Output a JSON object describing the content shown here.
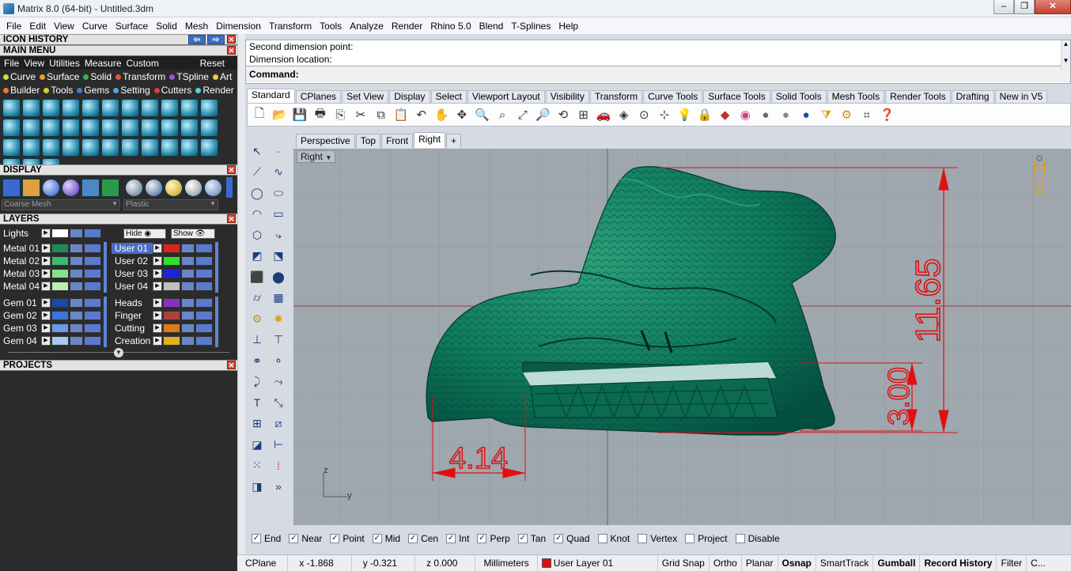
{
  "window": {
    "title": "Matrix 8.0 (64-bit) - Untitled.3dm",
    "min": "–",
    "max": "❐",
    "close": "✕"
  },
  "menubar": [
    "File",
    "Edit",
    "View",
    "Curve",
    "Surface",
    "Solid",
    "Mesh",
    "Dimension",
    "Transform",
    "Tools",
    "Analyze",
    "Render",
    "Rhino 5.0",
    "Blend",
    "T-Splines",
    "Help"
  ],
  "left": {
    "icon_history": "ICON HISTORY",
    "main_menu": "MAIN MENU",
    "mm_top": [
      "File",
      "View",
      "Utilities",
      "Measure",
      "Custom"
    ],
    "reset": "Reset",
    "mm_row2": [
      {
        "label": "Curve",
        "color": "#d8d84a"
      },
      {
        "label": "Surface",
        "color": "#e0a030"
      },
      {
        "label": "Solid",
        "color": "#3cb05a"
      },
      {
        "label": "Transform",
        "color": "#d85a3a"
      },
      {
        "label": "TSpline",
        "color": "#9060c8"
      },
      {
        "label": "Art",
        "color": "#e0d040"
      }
    ],
    "mm_row3": [
      {
        "label": "Builder",
        "color": "#e07a30"
      },
      {
        "label": "Tools",
        "color": "#d8c840"
      },
      {
        "label": "Gems",
        "color": "#4a7ad8"
      },
      {
        "label": "Setting",
        "color": "#50a8e0"
      },
      {
        "label": "Cutters",
        "color": "#d84040"
      },
      {
        "label": "Render",
        "color": "#5ad0d0"
      }
    ],
    "display": "DISPLAY",
    "display_sel1": "Coarse Mesh",
    "display_sel2": "Plastic",
    "layers": "LAYERS",
    "lights": "Lights",
    "hide": "Hide",
    "show": "Show",
    "layer_left_a": [
      {
        "name": "Metal 01",
        "color": "#1e8a5a"
      },
      {
        "name": "Metal 02",
        "color": "#3cb870"
      },
      {
        "name": "Metal 03",
        "color": "#86e08a"
      },
      {
        "name": "Metal 04",
        "color": "#b8f0b0"
      }
    ],
    "layer_right_a": [
      {
        "name": "User 01",
        "color": "#e02020",
        "sel": true
      },
      {
        "name": "User 02",
        "color": "#30e030"
      },
      {
        "name": "User 03",
        "color": "#2020e0"
      },
      {
        "name": "User 04",
        "color": "#c0c0c0"
      }
    ],
    "layer_left_b": [
      {
        "name": "Gem 01",
        "color": "#1a4aa8"
      },
      {
        "name": "Gem 02",
        "color": "#3c74d8"
      },
      {
        "name": "Gem 03",
        "color": "#6a9ae8"
      },
      {
        "name": "Gem 04",
        "color": "#a8c8f0"
      }
    ],
    "layer_right_b": [
      {
        "name": "Heads",
        "color": "#8a30c0"
      },
      {
        "name": "Finger",
        "color": "#b04040"
      },
      {
        "name": "Cutting",
        "color": "#e07820"
      },
      {
        "name": "Creation",
        "color": "#e0b020"
      }
    ],
    "projects": "PROJECTS"
  },
  "command": {
    "line1": "Second dimension point:",
    "line2": "Dimension location:",
    "prompt": "Command:"
  },
  "toolbar_tabs": [
    "Standard",
    "CPlanes",
    "Set View",
    "Display",
    "Select",
    "Viewport Layout",
    "Visibility",
    "Transform",
    "Curve Tools",
    "Surface Tools",
    "Solid Tools",
    "Mesh Tools",
    "Render Tools",
    "Drafting",
    "New in V5"
  ],
  "viewport_tabs": [
    "Perspective",
    "Top",
    "Front",
    "Right",
    "+"
  ],
  "viewport": {
    "name": "Right",
    "dim_height": "11.65",
    "dim_inner": "3.00",
    "dim_width": "4.14",
    "axis_z": "z",
    "axis_y": "y",
    "dim_color": "#e01010",
    "model_color": "#0e7a5c"
  },
  "osnap": [
    {
      "label": "End",
      "on": true
    },
    {
      "label": "Near",
      "on": true
    },
    {
      "label": "Point",
      "on": true
    },
    {
      "label": "Mid",
      "on": true
    },
    {
      "label": "Cen",
      "on": true
    },
    {
      "label": "Int",
      "on": true
    },
    {
      "label": "Perp",
      "on": true
    },
    {
      "label": "Tan",
      "on": true
    },
    {
      "label": "Quad",
      "on": true
    },
    {
      "label": "Knot",
      "on": false
    },
    {
      "label": "Vertex",
      "on": false
    },
    {
      "label": "Project",
      "on": false
    },
    {
      "label": "Disable",
      "on": false
    }
  ],
  "status": {
    "cplane": "CPlane",
    "x": "x -1.868",
    "y": "y -0.321",
    "z": "z 0.000",
    "units": "Millimeters",
    "layer": "User Layer 01",
    "layer_color": "#d81010",
    "grid_snap": "Grid Snap",
    "ortho": "Ortho",
    "planar": "Planar",
    "osnap": "Osnap",
    "smarttrack": "SmartTrack",
    "gumball": "Gumball",
    "record_history": "Record History",
    "filter": "Filter",
    "more": "C..."
  }
}
